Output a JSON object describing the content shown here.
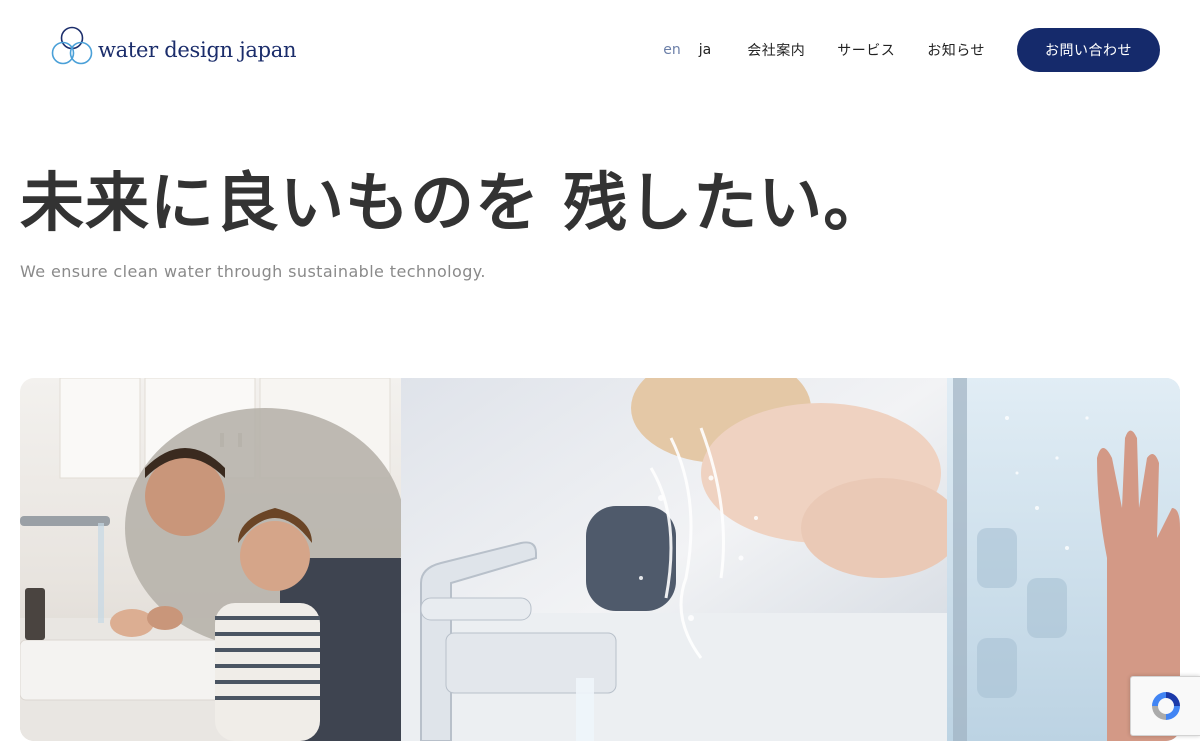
{
  "brand": {
    "name": "water design japan",
    "logo_color": "#1b2d6b",
    "ring_color": "#4aa0d8"
  },
  "nav": {
    "lang_en": "en",
    "lang_ja": "ja",
    "items": [
      "会社案内",
      "サービス",
      "お知らせ"
    ],
    "cta": "お問い合わせ",
    "cta_color": "#152a6b"
  },
  "hero": {
    "title": "未来に良いものを 残したい。",
    "subtitle": "We ensure clean water through sustainable technology."
  },
  "banner": {
    "panels": [
      "father-child-washing-hands-photo",
      "face-washing-splash-photo",
      "hand-in-shower-photo"
    ]
  },
  "recaptcha": {
    "icon": "recaptcha-icon"
  }
}
